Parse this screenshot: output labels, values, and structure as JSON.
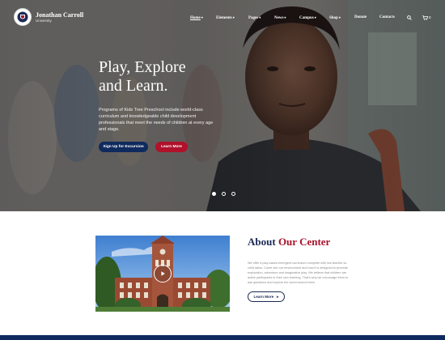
{
  "brand": {
    "name": "Jonathan Carroll",
    "subtitle": "University"
  },
  "nav": {
    "items": [
      {
        "label": "Home",
        "has_dropdown": true,
        "active": true
      },
      {
        "label": "Elements",
        "has_dropdown": true
      },
      {
        "label": "Pages",
        "has_dropdown": true
      },
      {
        "label": "News",
        "has_dropdown": true
      },
      {
        "label": "Campus",
        "has_dropdown": true
      },
      {
        "label": "Shop",
        "has_dropdown": true
      },
      {
        "label": "Donate",
        "has_dropdown": false
      },
      {
        "label": "Contacts",
        "has_dropdown": false
      }
    ],
    "search_icon": "search-icon",
    "cart_icon": "cart-icon",
    "cart_count": "0",
    "caret": "▾"
  },
  "hero": {
    "heading_line1": "Play, Explore",
    "heading_line2": "and Learn.",
    "text": "Programs of Kids Tree Preschool include world-class curriculum and knowledgeable child development professionals that meet the needs of children at every age and stage.",
    "primary_button": "Sign Up for Excursion",
    "secondary_button": "Learn More",
    "slides": 3,
    "active_slide": 1
  },
  "about": {
    "title_part1": "About",
    "title_part2": "Our Center",
    "text": "We offer a play-based emergent curriculum complete with low teacher-to-child ratios. Come see our environment and how it is designed to promote exploration, adventure and imaginative play. We believe that children are active participants in their own learning. That's why we encourage them to ask questions and explore the world around them.",
    "button": "Learn More",
    "button_arrow": "➤",
    "play_icon": "play-icon"
  },
  "colors": {
    "navy": "#1b2a55",
    "dark_navy": "#0f2a5e",
    "crimson": "#a8122a",
    "red_button": "#b0122b"
  }
}
